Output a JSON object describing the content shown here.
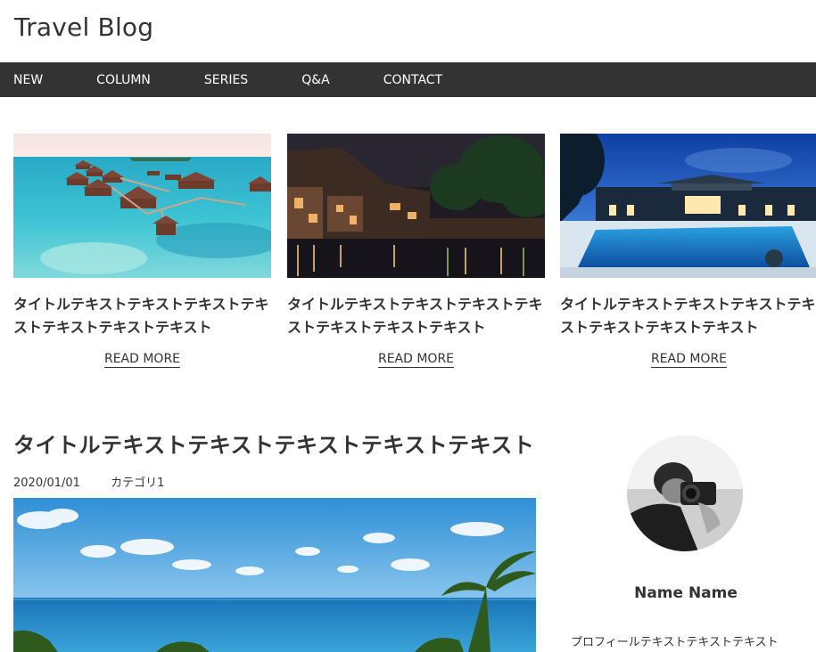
{
  "site": {
    "title": "Travel Blog"
  },
  "nav": {
    "items": [
      "NEW",
      "COLUMN",
      "SERIES",
      "Q&A",
      "CONTACT"
    ]
  },
  "cards": [
    {
      "title": "タイトルテキストテキストテキストテキストテキストテキストテキスト",
      "more": "READ MORE",
      "image": "maldives-water-villas"
    },
    {
      "title": "タイトルテキストテキストテキストテキストテキストテキストテキスト",
      "more": "READ MORE",
      "image": "night-canal-town"
    },
    {
      "title": "タイトルテキストテキストテキストテキストテキストテキストテキスト",
      "more": "READ MORE",
      "image": "resort-pool-night"
    }
  ],
  "post": {
    "title": "タイトルテキストテキストテキストテキストテキスト",
    "date": "2020/01/01",
    "category": "カテゴリ1",
    "image": "ocean-palm-sky"
  },
  "profile": {
    "name": "Name Name",
    "text": "プロフィールテキストテキストテキスト",
    "avatar": "photographer-avatar"
  }
}
